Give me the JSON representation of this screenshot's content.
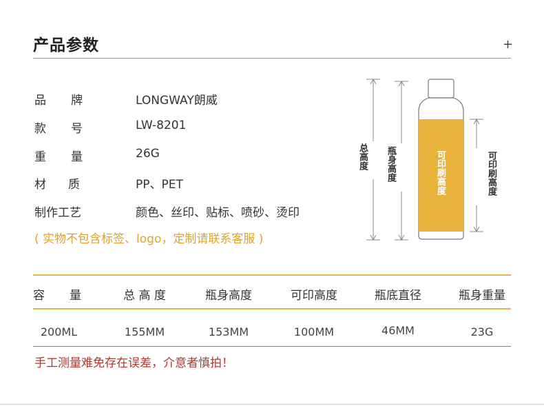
{
  "header": {
    "title": "产品参数",
    "plus_symbol": "+"
  },
  "specs": [
    {
      "label": "品 牌",
      "label_chars": [
        "品",
        "牌"
      ],
      "value": "LONGWAY朗威"
    },
    {
      "label": "款 号",
      "label_chars": [
        "款",
        "号"
      ],
      "value": "LW-8201"
    },
    {
      "label": "重 量",
      "label_chars": [
        "重",
        "量"
      ],
      "value": "26G"
    },
    {
      "label": "材 质",
      "label_chars": [
        "材",
        "质"
      ],
      "value": "PP、PET"
    },
    {
      "label": "制作工艺",
      "label_chars": [
        "制作工艺"
      ],
      "value": "颜色、丝印、贴标、喷砂、烫印"
    }
  ],
  "note": "( 实物不包含标签、logo，定制请联系客服 )",
  "diagram": {
    "total_height_label": "总高度",
    "body_height_label": "瓶身高度",
    "print_area_label": "可印刷高度",
    "print_height_label": "可印刷高度",
    "colors": {
      "print_area": "#e8b43c",
      "dimension_line": "#888888",
      "bottle_outline": "#777777"
    }
  },
  "table": {
    "headers": [
      "容 量",
      "总 高 度",
      "瓶身高度",
      "可印高度",
      "瓶底直径",
      "瓶身重量"
    ],
    "rows": [
      [
        "200ML",
        "155MM",
        "153MM",
        "100MM",
        "46MM",
        "23G"
      ]
    ]
  },
  "warning": "手工测量难免存在误差，介意者慎拍！",
  "colors": {
    "accent_gold": "#e2b44c",
    "note_orange": "#e0a326",
    "warning_red": "#b03a2e"
  }
}
